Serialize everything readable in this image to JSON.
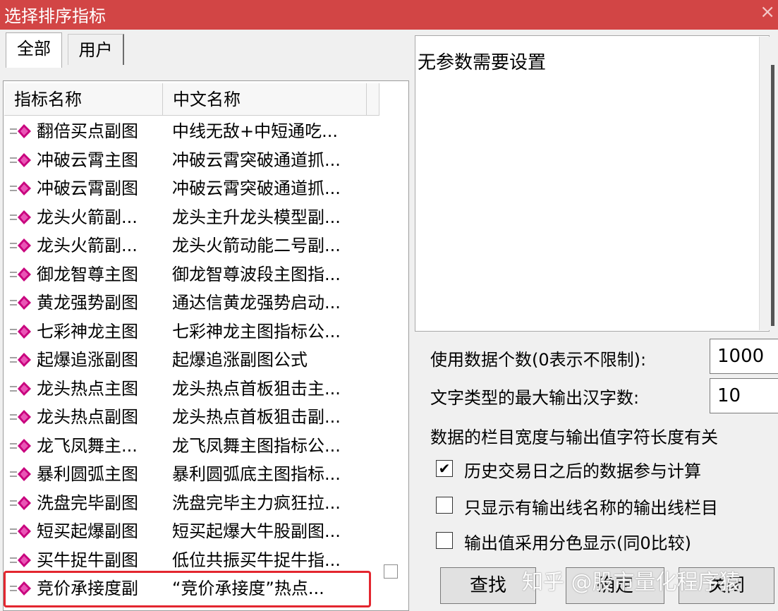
{
  "window": {
    "title": "选择排序指标",
    "close_glyph": "×"
  },
  "tabs": [
    {
      "label": "全部",
      "active": true
    },
    {
      "label": "用户",
      "active": false
    }
  ],
  "list": {
    "columns": [
      "指标名称",
      "中文名称"
    ],
    "rows": [
      {
        "name": "翻倍买点副图",
        "cn": "中线无敌+中短通吃..."
      },
      {
        "name": "冲破云霄主图",
        "cn": "冲破云霄突破通道抓..."
      },
      {
        "name": "冲破云霄副图",
        "cn": "冲破云霄突破通道抓..."
      },
      {
        "name": "龙头火箭副...",
        "cn": "龙头主升龙头模型副..."
      },
      {
        "name": "龙头火箭副...",
        "cn": "龙头火箭动能二号副..."
      },
      {
        "name": "御龙智尊主图",
        "cn": "御龙智尊波段主图指..."
      },
      {
        "name": "黄龙强势副图",
        "cn": "通达信黄龙强势启动..."
      },
      {
        "name": "七彩神龙主图",
        "cn": "七彩神龙主图指标公..."
      },
      {
        "name": "起爆追涨副图",
        "cn": "起爆追涨副图公式"
      },
      {
        "name": "龙头热点主图",
        "cn": "龙头热点首板狙击主..."
      },
      {
        "name": "龙头热点副图",
        "cn": "龙头热点首板狙击副..."
      },
      {
        "name": "龙飞凤舞主...",
        "cn": "龙飞凤舞主图指标公..."
      },
      {
        "name": "暴利圆弧主图",
        "cn": "暴利圆弧底主图指标..."
      },
      {
        "name": "洗盘完毕副图",
        "cn": "洗盘完毕主力疯狂拉..."
      },
      {
        "name": "短买起爆副图",
        "cn": "短买起爆大牛股副图..."
      },
      {
        "name": "买牛捉牛副图",
        "cn": "低位共振买牛捉牛指..."
      },
      {
        "name": "竞价承接度副",
        "cn": "“竞价承接度”热点..."
      }
    ]
  },
  "params": {
    "message": "无参数需要设置",
    "data_count_label": "使用数据个数(0表示不限制):",
    "data_count_value": "1000",
    "max_chars_label": "文字类型的最大输出汉字数:",
    "max_chars_value": "10",
    "width_note": "数据的栏目宽度与输出值字符长度有关",
    "checkboxes": [
      {
        "label": "历史交易日之后的数据参与计算",
        "checked": true
      },
      {
        "label": "只显示有输出线名称的输出线栏目",
        "checked": false
      },
      {
        "label": "输出值采用分色显示(同0比较)",
        "checked": false
      }
    ]
  },
  "buttons": {
    "find": "查找",
    "ok": "确定",
    "close": "关闭"
  },
  "watermark": "知乎 @股市量化程序猿",
  "colors": {
    "titlebar": "#d24545",
    "highlight": "#e3262f",
    "icon_diamond": "#c8007d"
  }
}
